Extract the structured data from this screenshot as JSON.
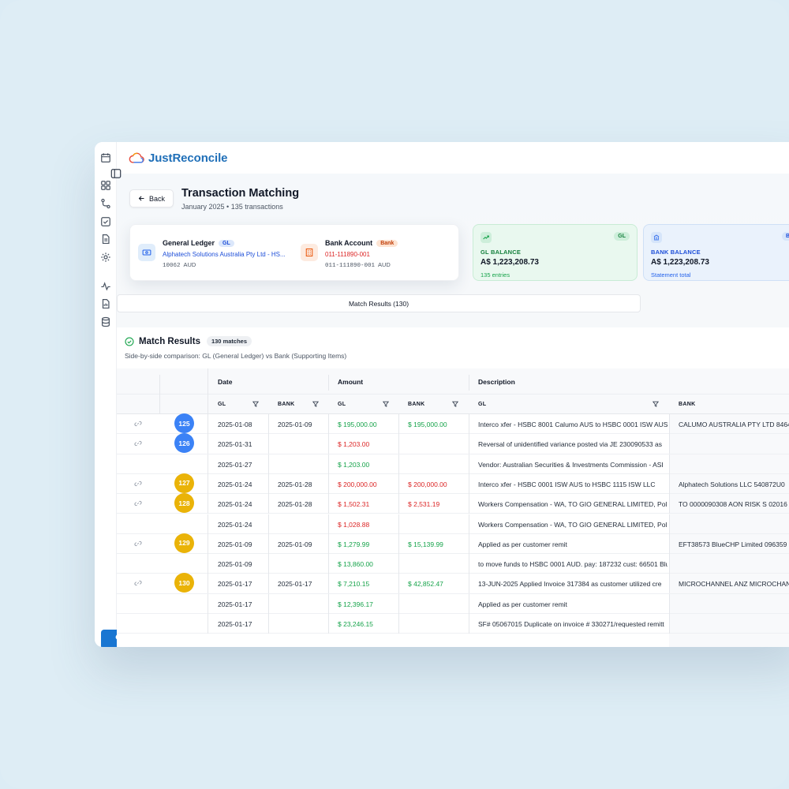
{
  "app": {
    "brand": "JustReconcile",
    "colors": {
      "brand": "#1f6fb8",
      "accent": "#1976d2",
      "green": "#16a34a",
      "red": "#dc2626",
      "blue_badge": "#3b82f6",
      "amber_badge": "#eab308"
    }
  },
  "header": {
    "back_label": "Back",
    "title": "Transaction Matching",
    "subtitle": "January 2025 • 135 transactions"
  },
  "accounts": {
    "gl": {
      "title": "General Ledger",
      "tag": "GL",
      "entity": "Alphatech Solutions Australia Pty Ltd - HS...",
      "code": "10062",
      "currency": "AUD",
      "icon": "bank-note-icon"
    },
    "bank": {
      "title": "Bank Account",
      "tag": "Bank",
      "number": "011-111890-001",
      "code": "011-111890-001",
      "currency": "AUD",
      "icon": "building-icon"
    }
  },
  "balances": {
    "gl": {
      "label": "GL BALANCE",
      "badge": "GL",
      "value": "A$ 1,223,208.73",
      "sub": "135 entries",
      "icon": "trend-up-icon"
    },
    "bank": {
      "label": "BANK BALANCE",
      "badge": "Ba",
      "value": "A$ 1,223,208.73",
      "sub": "Statement total",
      "icon": "bank-icon"
    }
  },
  "tab": {
    "label": "Match Results (130)"
  },
  "results": {
    "title": "Match Results",
    "badge": "130 matches",
    "subtitle": "Side-by-side comparison: GL (General Ledger) vs Bank (Supporting Items)"
  },
  "table": {
    "groups": {
      "date": "Date",
      "amount": "Amount",
      "description": "Description"
    },
    "sub": {
      "gl": "GL",
      "bank": "BANK"
    },
    "rows": [
      {
        "link": true,
        "num": "125",
        "color": "blue",
        "gl_date": "2025-01-08",
        "bank_date": "2025-01-09",
        "gl_amt": "$ 195,000.00",
        "gl_amt_color": "green",
        "bank_amt": "$ 195,000.00",
        "bank_amt_color": "green",
        "gl_desc": "Interco xfer - HSBC 8001 Calumo AUS to HSBC 0001 ISW AUS",
        "bank_desc": "CALUMO AUSTRALIA PTY LTD 8464"
      },
      {
        "link": true,
        "num": "126",
        "color": "blue",
        "gl_date": "2025-01-31",
        "bank_date": "",
        "gl_amt": "$ 1,203.00",
        "gl_amt_color": "red",
        "bank_amt": "",
        "bank_amt_color": "",
        "gl_desc": "Reversal of unidentified variance posted via JE 230090533 as",
        "bank_desc": ""
      },
      {
        "link": false,
        "num": "",
        "color": "",
        "gl_date": "2025-01-27",
        "bank_date": "",
        "gl_amt": "$ 1,203.00",
        "gl_amt_color": "green",
        "bank_amt": "",
        "bank_amt_color": "",
        "gl_desc": "Vendor: Australian Securities & Investments Commission - ASI",
        "bank_desc": ""
      },
      {
        "link": true,
        "num": "127",
        "color": "amber",
        "gl_date": "2025-01-24",
        "bank_date": "2025-01-28",
        "gl_amt": "$ 200,000.00",
        "gl_amt_color": "red",
        "bank_amt": "$ 200,000.00",
        "bank_amt_color": "red",
        "gl_desc": "Interco xfer - HSBC 0001 ISW AUS to HSBC 1115 ISW LLC",
        "bank_desc": "Alphatech Solutions LLC 540872U0"
      },
      {
        "link": true,
        "num": "128",
        "color": "amber",
        "gl_date": "2025-01-24",
        "bank_date": "2025-01-28",
        "gl_amt": "$ 1,502.31",
        "gl_amt_color": "red",
        "bank_amt": "$ 2,531.19",
        "bank_amt_color": "red",
        "gl_desc": "Workers Compensation - WA, TO GIO GENERAL LIMITED, Polic",
        "bank_desc": "TO 0000090308 AON RISK S 02016"
      },
      {
        "link": false,
        "num": "",
        "color": "",
        "gl_date": "2025-01-24",
        "bank_date": "",
        "gl_amt": "$ 1,028.88",
        "gl_amt_color": "red",
        "bank_amt": "",
        "bank_amt_color": "",
        "gl_desc": "Workers Compensation - WA, TO GIO GENERAL LIMITED, Polic",
        "bank_desc": ""
      },
      {
        "link": true,
        "num": "129",
        "color": "amber",
        "gl_date": "2025-01-09",
        "bank_date": "2025-01-09",
        "gl_amt": "$ 1,279.99",
        "gl_amt_color": "green",
        "bank_amt": "$ 15,139.99",
        "bank_amt_color": "green",
        "gl_desc": "Applied as per customer remit",
        "bank_desc": "EFT38573 BlueCHP Limited 096359"
      },
      {
        "link": false,
        "num": "",
        "color": "",
        "gl_date": "2025-01-09",
        "bank_date": "",
        "gl_amt": "$ 13,860.00",
        "gl_amt_color": "green",
        "bank_amt": "",
        "bank_amt_color": "",
        "gl_desc": "to move funds to HSBC 0001 AUD. pay: 187232 cust: 66501 Blu",
        "bank_desc": ""
      },
      {
        "link": true,
        "num": "130",
        "color": "amber",
        "gl_date": "2025-01-17",
        "bank_date": "2025-01-17",
        "gl_amt": "$ 7,210.15",
        "gl_amt_color": "green",
        "bank_amt": "$ 42,852.47",
        "bank_amt_color": "green",
        "gl_desc": "13-JUN-2025 Applied Invoice 317384 as customer utilized cre",
        "bank_desc": "MICROCHANNEL ANZ MICROCHAN"
      },
      {
        "link": false,
        "num": "",
        "color": "",
        "gl_date": "2025-01-17",
        "bank_date": "",
        "gl_amt": "$ 12,396.17",
        "gl_amt_color": "green",
        "bank_amt": "",
        "bank_amt_color": "",
        "gl_desc": "Applied as per customer remit",
        "bank_desc": ""
      },
      {
        "link": false,
        "num": "",
        "color": "",
        "gl_date": "2025-01-17",
        "bank_date": "",
        "gl_amt": "$ 23,246.15",
        "gl_amt_color": "green",
        "bank_amt": "",
        "bank_amt_color": "",
        "gl_desc": "SF# 05067015 Duplicate on invoice # 330271/requested remitt",
        "bank_desc": ""
      }
    ]
  }
}
